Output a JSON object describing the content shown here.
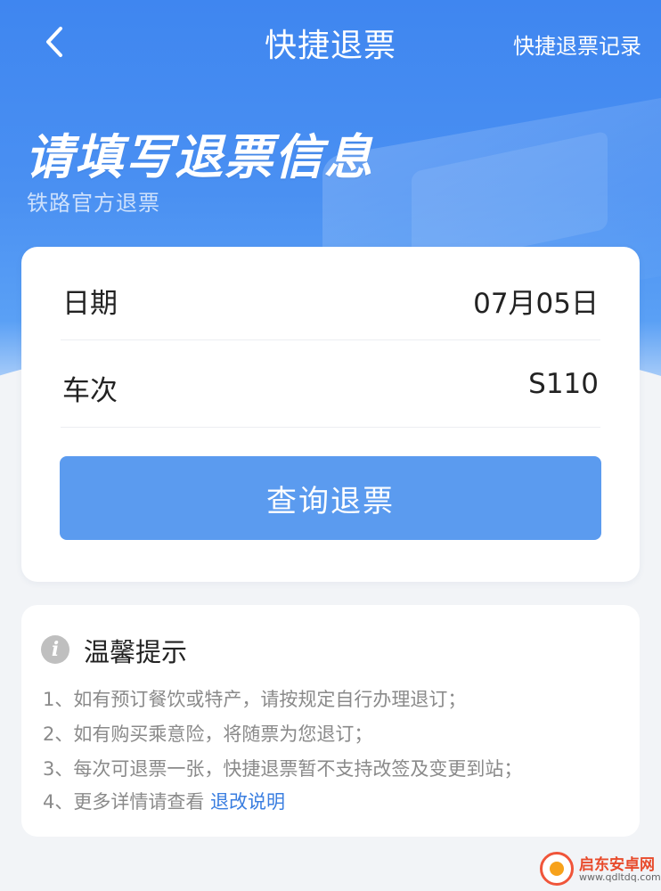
{
  "nav": {
    "title": "快捷退票",
    "records_label": "快捷退票记录"
  },
  "hero": {
    "title": "请填写退票信息",
    "subtitle": "铁路官方退票"
  },
  "form": {
    "rows": [
      {
        "label": "日期",
        "value": "07月05日"
      },
      {
        "label": "车次",
        "value": "S110"
      }
    ],
    "submit_label": "查询退票"
  },
  "tips": {
    "title": "温馨提示",
    "items": [
      "1、如有预订餐饮或特产，请按规定自行办理退订；",
      "2、如有购买乘意险，将随票为您退订；",
      "3、每次可退票一张，快捷退票暂不支持改签及变更到站；",
      "4、更多详情请查看 "
    ],
    "link_label": "退改说明"
  },
  "watermark": {
    "name": "启东安卓网",
    "url": "www.qdltdq.com"
  },
  "colors": {
    "brand_blue": "#4a90f2",
    "button_blue": "#5b9bef",
    "link_blue": "#3a7ee0"
  }
}
